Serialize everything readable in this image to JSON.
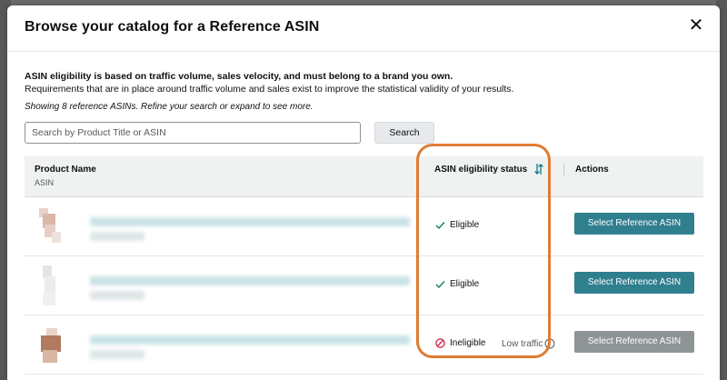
{
  "modal": {
    "title": "Browse your catalog for a Reference ASIN",
    "close_label": "✕"
  },
  "description": {
    "bold_line": "ASIN eligibility is based on traffic volume, sales velocity, and must belong to a brand you own.",
    "plain_line": "Requirements that are in place around traffic volume and sales exist to improve the statistical validity of your results.",
    "italic_line": "Showing 8 reference ASINs. Refine your search or expand to see more."
  },
  "search": {
    "placeholder": "Search by Product Title or ASIN",
    "value": "",
    "button_label": "Search"
  },
  "table": {
    "headers": {
      "product_name": "Product Name",
      "asin": "ASIN",
      "eligibility": "ASIN eligibility status",
      "actions": "Actions"
    },
    "rows": [
      {
        "status": "Eligible",
        "status_type": "eligible",
        "note": "",
        "action_label": "Select Reference ASIN",
        "action_enabled": true
      },
      {
        "status": "Eligible",
        "status_type": "eligible",
        "note": "",
        "action_label": "Select Reference ASIN",
        "action_enabled": true
      },
      {
        "status": "Ineligible",
        "status_type": "ineligible",
        "note": "Low traffic",
        "action_label": "Select Reference ASIN",
        "action_enabled": false
      }
    ]
  },
  "colors": {
    "primary_button": "#2f7f8f",
    "disabled_button": "#8f9596",
    "eligible_check": "#067d62",
    "ineligible_icon": "#cc0c39",
    "highlight": "#e07b33",
    "sort_icon": "#007185"
  },
  "icons": {
    "close": "close-icon",
    "sort": "sort-icon",
    "eligible": "check-icon",
    "ineligible": "prohibited-icon",
    "info": "info-icon"
  }
}
